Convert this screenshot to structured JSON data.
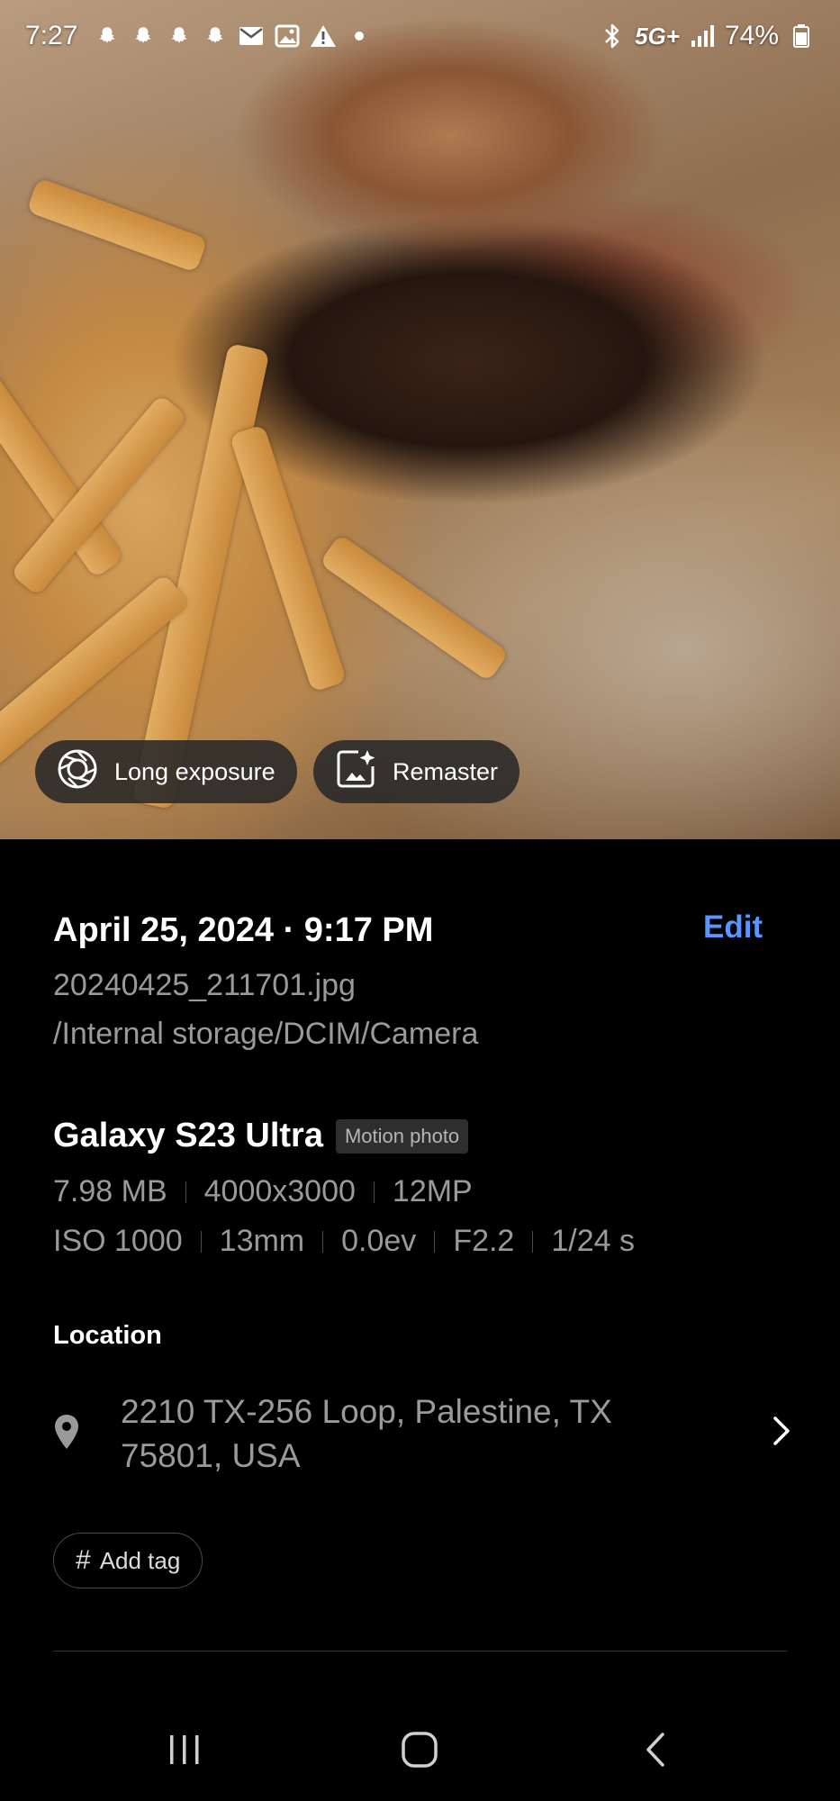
{
  "status_bar": {
    "time": "7:27",
    "network": "5G+",
    "battery": "74%"
  },
  "photo_actions": {
    "long_exposure_label": "Long exposure",
    "remaster_label": "Remaster"
  },
  "details": {
    "date_time": "April 25, 2024 · 9:17 PM",
    "edit_label": "Edit",
    "file_name": "20240425_211701.jpg",
    "file_path": "/Internal storage/DCIM/Camera",
    "device": "Galaxy S23 Ultra",
    "badge": "Motion photo",
    "file_info": [
      "7.98 MB",
      "4000x3000",
      "12MP"
    ],
    "camera_info": [
      "ISO 1000",
      "13mm",
      "0.0ev",
      "F2.2",
      "1/24 s"
    ],
    "location_label": "Location",
    "location_address": "2210 TX-256 Loop, Palestine, TX 75801, USA",
    "add_tag_label": "Add tag"
  },
  "colors": {
    "accent": "#5b95ff",
    "secondary_text": "#9a9a9a"
  }
}
